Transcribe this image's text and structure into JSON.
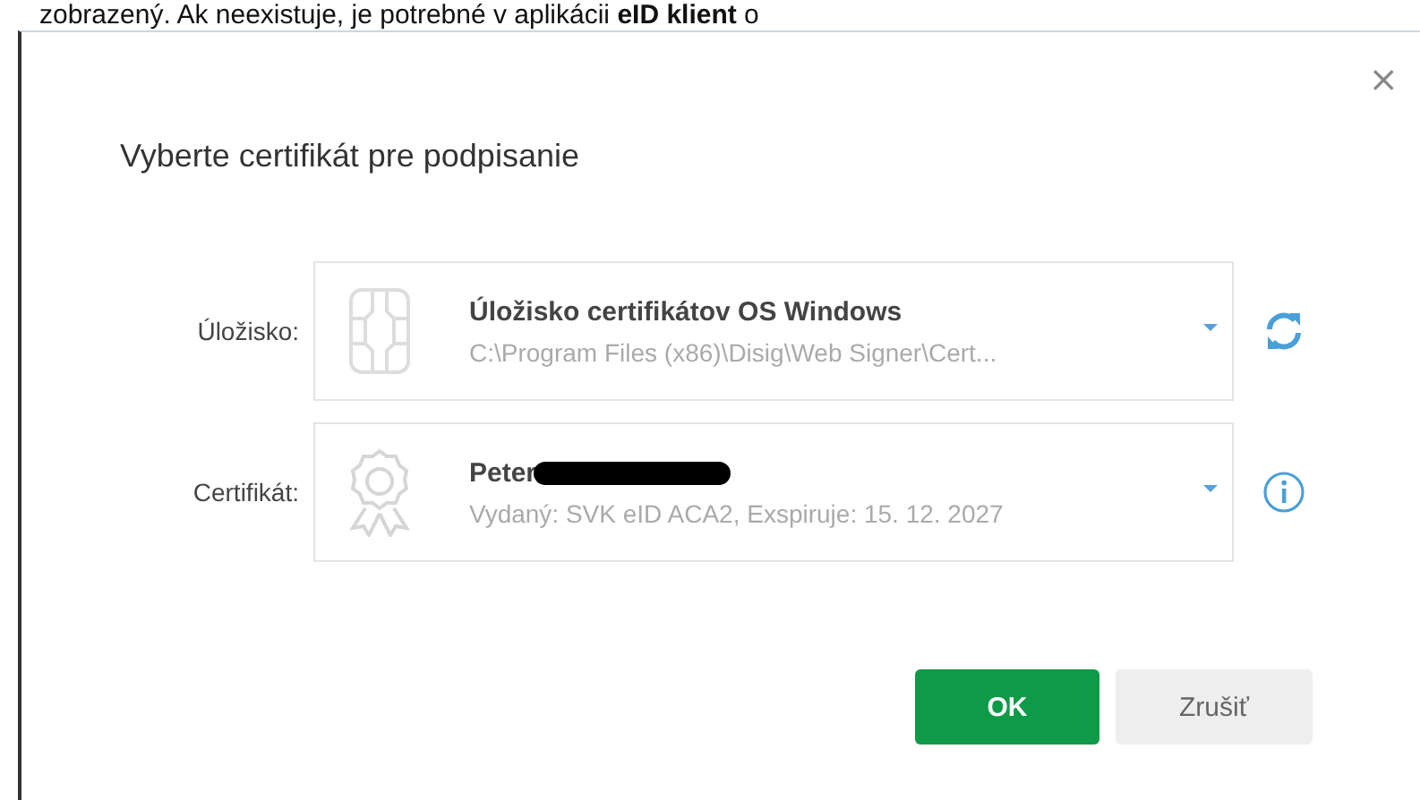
{
  "page_text": "zobrazený. Ak neexistuje, je potrebné v aplikácii **eID klient** o",
  "dialog": {
    "close": "×",
    "title": "Vyberte certifikát pre podpisanie",
    "fields": [
      {
        "kind": "store",
        "label": "Úložisko:",
        "primary": "Úložisko certifikátov OS Windows",
        "secondary": "C:\\Program Files (x86)\\Disig\\Web Signer\\Cert...",
        "redacted": false
      },
      {
        "kind": "certificate",
        "label": "Certifikát:",
        "primary": "Peter",
        "secondary": "Vydaný: SVK eID ACA2, Exspiruje: 15. 12. 2027",
        "redacted": true
      }
    ],
    "buttons": [
      {
        "label": "OK",
        "kind": "primary"
      },
      {
        "label": "Zrušiť",
        "kind": "secondary"
      }
    ]
  }
}
